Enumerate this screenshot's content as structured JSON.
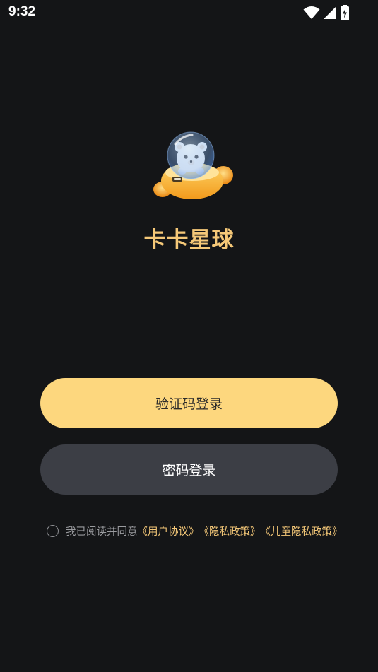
{
  "status_bar": {
    "time": "9:32",
    "icons": [
      "wifi-icon",
      "cellular-signal-icon",
      "battery-charging-icon"
    ]
  },
  "app": {
    "name": "卡卡星球",
    "logo_icon": "bear-astronaut-mascot-icon",
    "brand_color": "#f5c878"
  },
  "buttons": {
    "sms_login_label": "验证码登录",
    "password_login_label": "密码登录",
    "primary_color": "#fdd77e",
    "secondary_color": "#3c3e45"
  },
  "agreement": {
    "checked": false,
    "prefix": "我已阅读并同意",
    "user_agreement": "《用户协议》",
    "privacy_policy": "《隐私政策》",
    "child_privacy_policy": "《儿童隐私政策》"
  },
  "colors": {
    "background": "#141517"
  }
}
